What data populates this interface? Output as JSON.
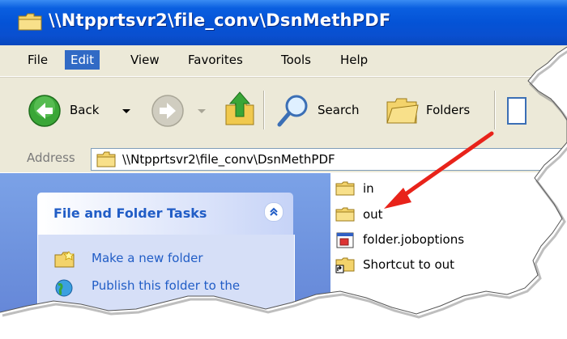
{
  "window": {
    "title": "\\\\Ntpprtsvr2\\file_conv\\DsnMethPDF"
  },
  "menu": {
    "items": [
      "File",
      "Edit",
      "View",
      "Favorites",
      "Tools",
      "Help"
    ],
    "active": "Edit"
  },
  "toolbar": {
    "back_label": "Back",
    "search_label": "Search",
    "folders_label": "Folders"
  },
  "address": {
    "label": "Address",
    "value": "\\\\Ntpprtsvr2\\file_conv\\DsnMethPDF"
  },
  "task_pane": {
    "header": "File and Folder Tasks",
    "links": [
      "Make a new folder",
      "Publish this folder to the"
    ]
  },
  "files": [
    {
      "name": "in",
      "icon": "folder-icon"
    },
    {
      "name": "out",
      "icon": "folder-icon"
    },
    {
      "name": "folder.joboptions",
      "icon": "joboptions-file-icon"
    },
    {
      "name": "Shortcut to out",
      "icon": "folder-shortcut-icon"
    }
  ],
  "colors": {
    "titlebar": "#0453d6",
    "menu_highlight": "#316ac5",
    "chrome": "#ece9d8",
    "task_link": "#215dc6",
    "annotation_arrow": "#e8231a"
  }
}
